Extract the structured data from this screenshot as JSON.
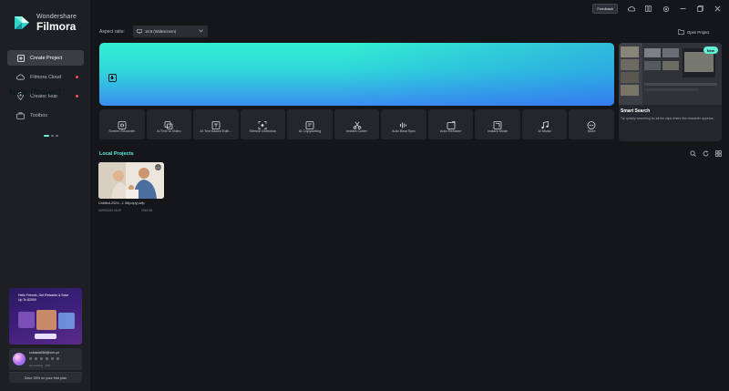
{
  "app": {
    "brand": "Wondershare",
    "name": "Filmora"
  },
  "sidebar": {
    "items": [
      {
        "label": "Create Project",
        "icon": "create-project-icon",
        "active": true,
        "dot": false
      },
      {
        "label": "Filmora Cloud",
        "icon": "cloud-icon",
        "active": false,
        "dot": true
      },
      {
        "label": "Creator Hub",
        "icon": "location-pin-icon",
        "active": false,
        "dot": true
      },
      {
        "label": "Toolbox",
        "icon": "toolbox-icon",
        "active": false,
        "dot": false
      }
    ],
    "promo": {
      "text": "Hello Friends, Get Rewards & Save Up To $2000"
    },
    "account": {
      "email": "sobasta666@mm.pe",
      "plan": "Go Creating · 10M"
    },
    "save_label": "Save 35% on your first plan"
  },
  "topbar": {
    "feedback_label": "Feedback",
    "icons": [
      "cloud-upload-icon",
      "apps-icon",
      "settings-icon",
      "minimize-icon",
      "restore-icon",
      "close-icon"
    ]
  },
  "header": {
    "aspect_label": "Aspect ratio:",
    "aspect_value": "16:9 (Widescreen)",
    "open_project_label": "Open Project"
  },
  "hero": {
    "new_project_label": "New Project"
  },
  "feature_card": {
    "badge": "New",
    "title": "Smart Search",
    "description": "Try quickly searching for all the clips where the character appears."
  },
  "tools": [
    {
      "label": "Screen Recorder",
      "icon": "screen-recorder-icon"
    },
    {
      "label": "AI Text to Video",
      "icon": "ai-text-to-video-icon"
    },
    {
      "label": "AI Text Based Editi...",
      "icon": "ai-text-based-editing-icon"
    },
    {
      "label": "Silence Detection",
      "icon": "silence-detection-icon"
    },
    {
      "label": "AI Copywriting",
      "icon": "ai-copywriting-icon"
    },
    {
      "label": "Instant Cutter",
      "icon": "scissors-icon"
    },
    {
      "label": "Auto Beat Sync",
      "icon": "beat-sync-icon"
    },
    {
      "label": "Auto Reframe",
      "icon": "reframe-icon"
    },
    {
      "label": "Instant Mode",
      "icon": "instant-mode-icon"
    },
    {
      "label": "AI Music",
      "icon": "music-note-icon"
    },
    {
      "label": "More",
      "icon": "more-icon"
    }
  ],
  "local_projects": {
    "title": "Local Projects",
    "actions": [
      "search-icon",
      "refresh-icon",
      "grid-view-icon"
    ],
    "items": [
      {
        "name": "Untitled-2024...1 46(copy).wfp",
        "date": "02/09/2024 18:09",
        "size": "2046 KB"
      }
    ]
  },
  "colors": {
    "accent": "#62f0d8",
    "hero_start": "#33f0d0",
    "hero_end": "#3a8ef0",
    "background": "#14161a",
    "sidebar": "#1d1f24"
  }
}
